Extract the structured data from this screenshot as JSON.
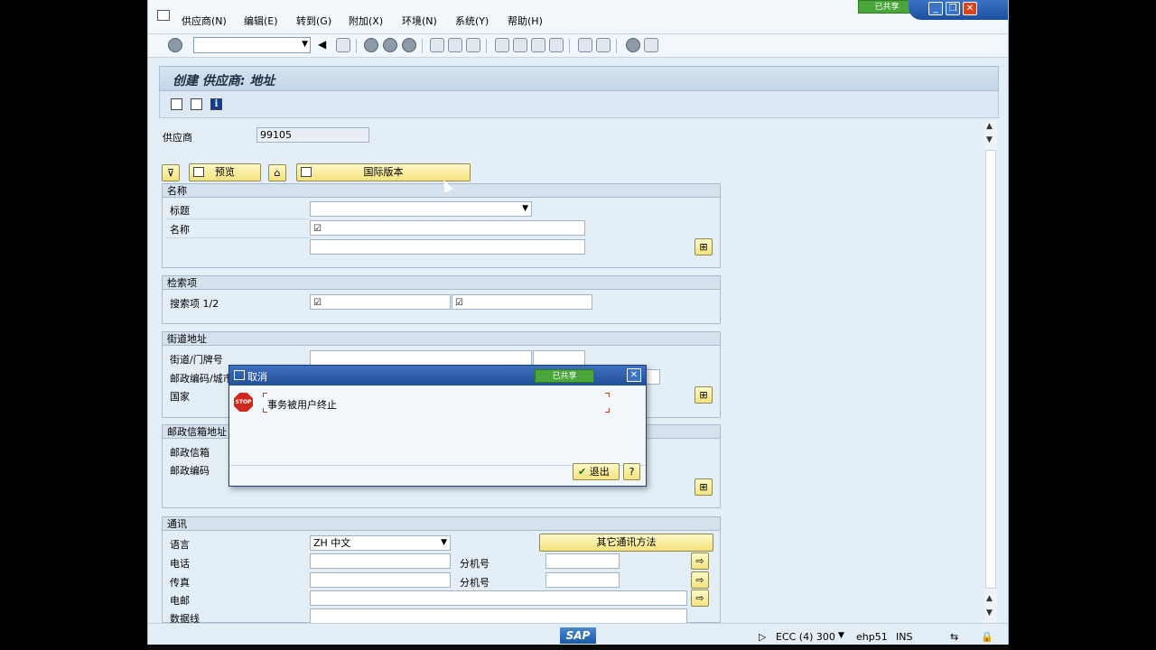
{
  "menu": {
    "items": [
      "供应商(N)",
      "编辑(E)",
      "转到(G)",
      "附加(X)",
      "环境(N)",
      "系统(Y)",
      "帮助(H)"
    ],
    "shared_badge": "已共享"
  },
  "window_controls": {
    "minimize": "_",
    "restore": "❐",
    "close": "✕"
  },
  "toolbar": {
    "command_field": ""
  },
  "screen": {
    "title": "创建 供应商: 地址"
  },
  "vendor": {
    "label": "供应商",
    "value": "99105"
  },
  "buttons": {
    "preview": "预览",
    "intl_version": "国际版本",
    "other_comm": "其它通讯方法"
  },
  "groups": {
    "name": {
      "header": "名称",
      "title_label": "标题",
      "name_label": "名称",
      "name_check": "☑"
    },
    "search": {
      "header": "检索项",
      "label": "搜索项 1/2",
      "check1": "☑",
      "check2": "☑"
    },
    "street": {
      "header": "街道地址",
      "street_label": "街道/门牌号",
      "postal_label": "邮政编码/城市",
      "country_label": "国家"
    },
    "pobox": {
      "header": "邮政信箱地址",
      "pobox_label": "邮政信箱",
      "postal_label": "邮政编码"
    },
    "comm": {
      "header": "通讯",
      "lang_label": "语言",
      "lang_value": "ZH 中文",
      "phone_label": "电话",
      "fax_label": "传真",
      "ext_label": "分机号",
      "email_label": "电邮",
      "dataline_label": "数据线"
    }
  },
  "dialog": {
    "title": "取消",
    "badge": "已共享",
    "message": "事务被用户终止",
    "exit_label": "退出",
    "stop_icon_text": "STOP"
  },
  "status": {
    "logo": "SAP",
    "system": "ECC (4) 300",
    "server": "ehp51",
    "mode": "INS"
  }
}
